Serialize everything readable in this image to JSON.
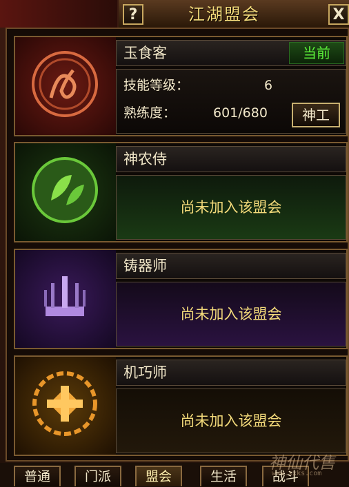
{
  "window": {
    "title": "江湖盟会",
    "help_label": "?",
    "close_label": "X"
  },
  "guilds": [
    {
      "name": "玉食客",
      "current_label": "当前",
      "skill_level_label": "技能等级：",
      "skill_level": "6",
      "proficiency_label": "熟练度：",
      "proficiency": "601/680",
      "button_label": "神工",
      "emblem_icon": "dragon-emblem-icon",
      "color": "#c8452a"
    },
    {
      "name": "神农侍",
      "status": "尚未加入该盟会",
      "emblem_icon": "leaf-emblem-icon",
      "color": "#5aa83a"
    },
    {
      "name": "铸器师",
      "status": "尚未加入该盟会",
      "emblem_icon": "forge-emblem-icon",
      "color": "#8a5acb"
    },
    {
      "name": "机巧师",
      "status": "尚未加入该盟会",
      "emblem_icon": "gear-emblem-icon",
      "color": "#e8962a"
    }
  ],
  "tabs": [
    {
      "label": "普通"
    },
    {
      "label": "门派"
    },
    {
      "label": "盟会",
      "active": true
    },
    {
      "label": "生活"
    },
    {
      "label": "战斗"
    }
  ],
  "watermark": {
    "text": "神仙代售",
    "url": "www.xxks.com"
  }
}
